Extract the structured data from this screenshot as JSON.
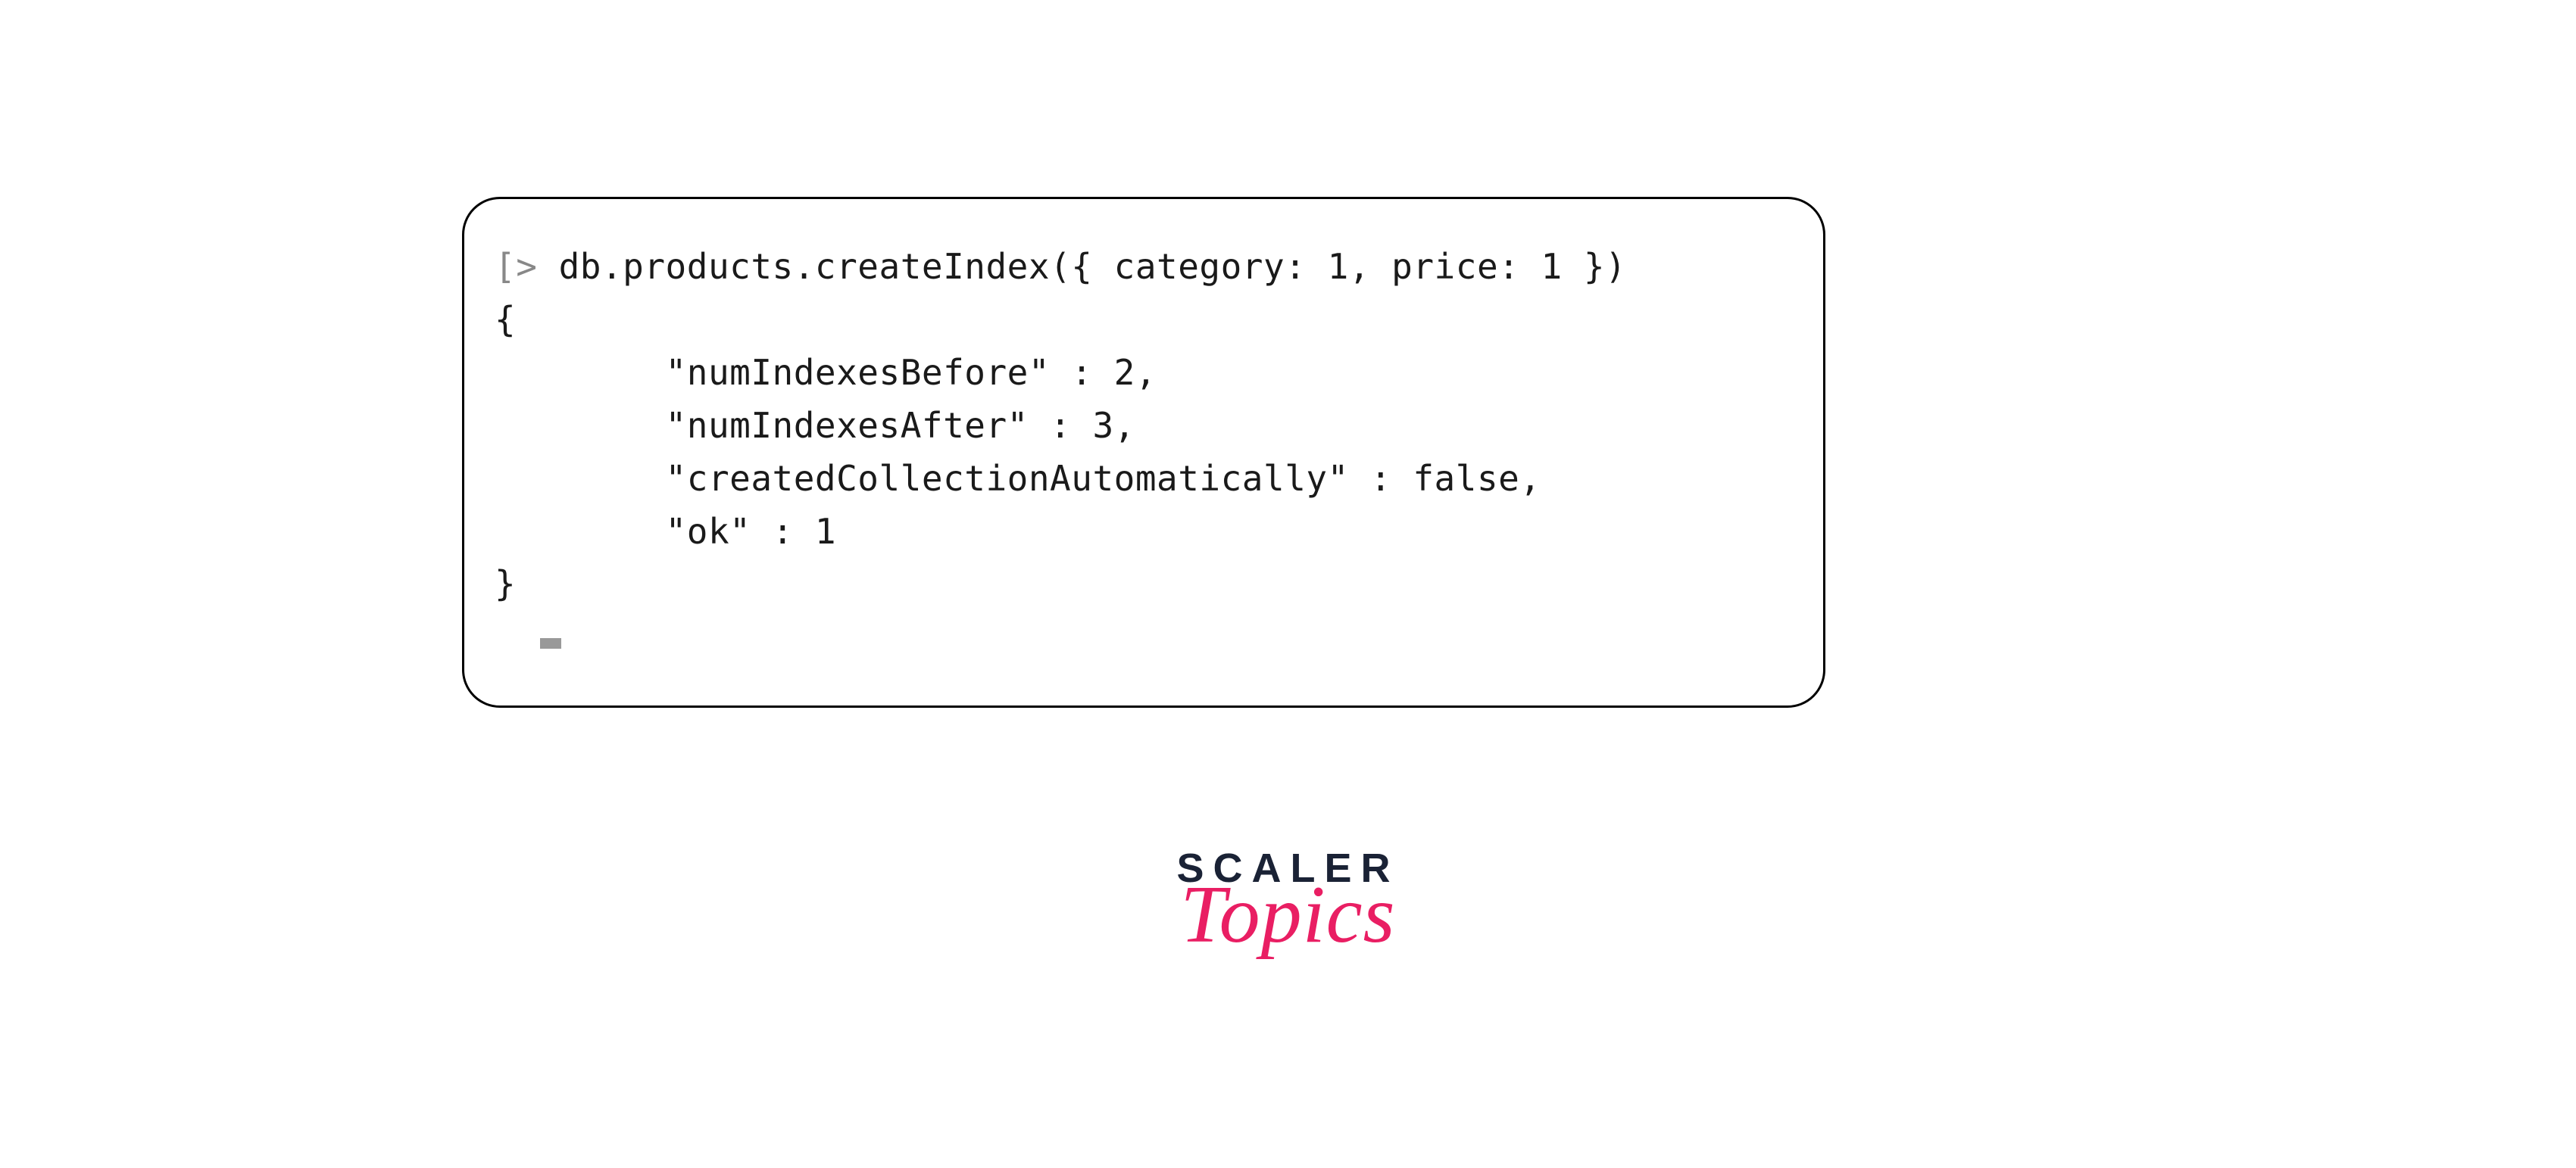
{
  "code": {
    "prompt_char": "[>",
    "command": " db.products.createIndex({ category: 1, price: 1 })",
    "output": {
      "open_brace": "{",
      "lines": [
        "        \"numIndexesBefore\" : 2,",
        "        \"numIndexesAfter\" : 3,",
        "        \"createdCollectionAutomatically\" : false,",
        "        \"ok\" : 1"
      ],
      "close_brace": "}"
    }
  },
  "logo": {
    "line1": "SCALER",
    "line2": "Topics"
  }
}
